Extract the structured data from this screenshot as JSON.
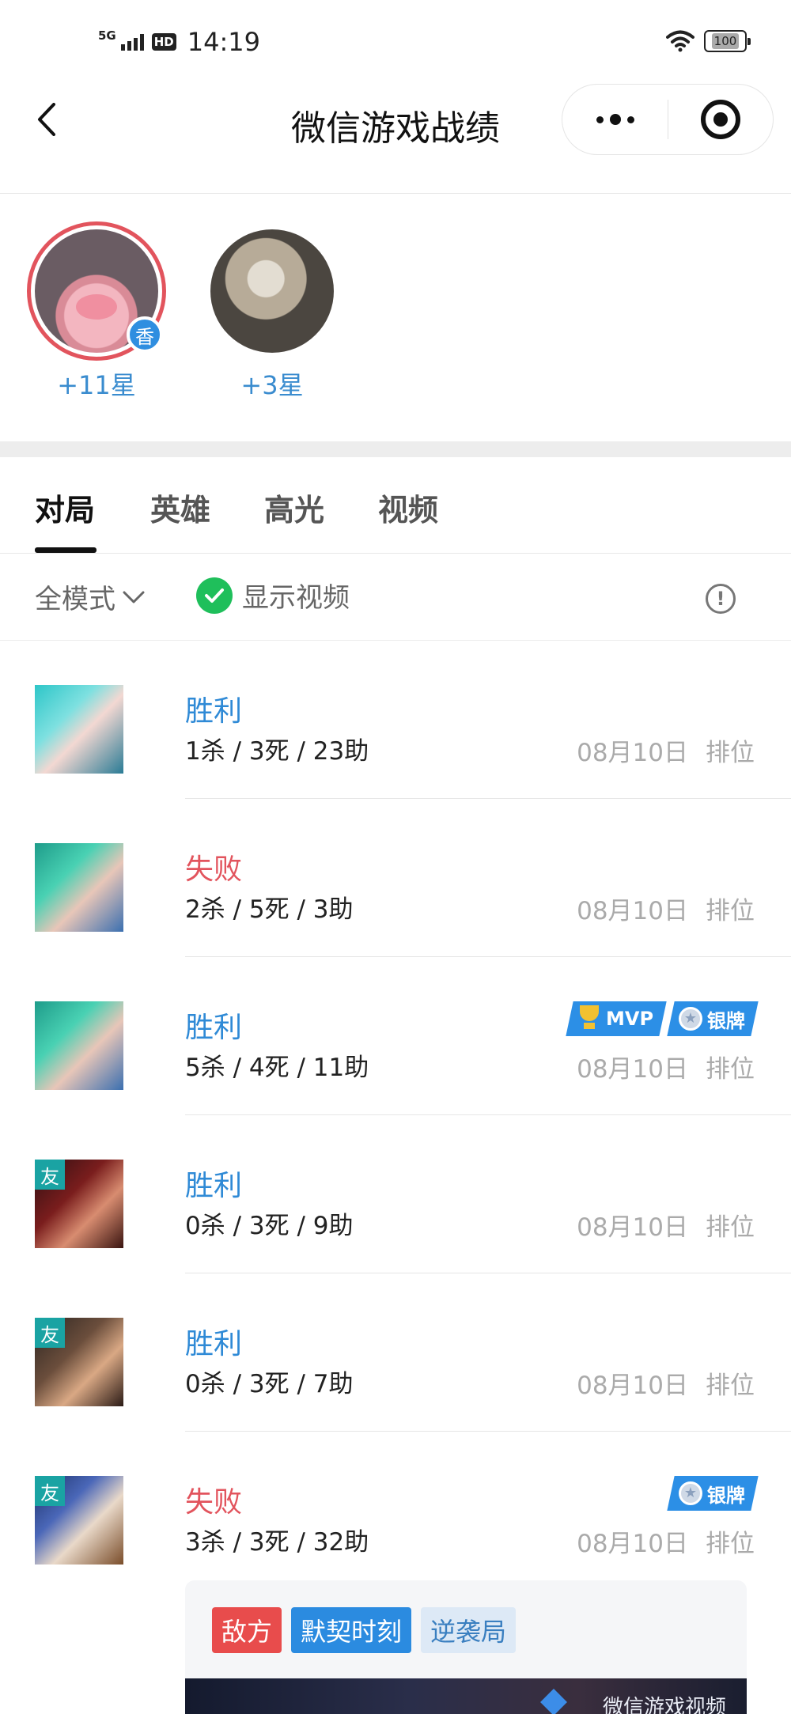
{
  "status_bar": {
    "network": "5G",
    "hd": "HD",
    "time": "14:19",
    "battery": "100"
  },
  "nav": {
    "title": "微信游戏战绩"
  },
  "friends": [
    {
      "label": "+11星",
      "badge": "香"
    },
    {
      "label": "+3星"
    }
  ],
  "tabs": [
    "对局",
    "英雄",
    "高光",
    "视频"
  ],
  "filter": {
    "mode": "全模式",
    "show_video": "显示视频",
    "info": "!"
  },
  "matches": [
    {
      "result": "胜利",
      "kda": "1杀 / 3死 / 23助",
      "date": "08月10日",
      "mode": "排位"
    },
    {
      "result": "失败",
      "kda": "2杀 / 5死 / 3助",
      "date": "08月10日",
      "mode": "排位"
    },
    {
      "result": "胜利",
      "kda": "5杀 / 4死 / 11助",
      "date": "08月10日",
      "mode": "排位",
      "badges": [
        "MVP",
        "银牌"
      ]
    },
    {
      "result": "胜利",
      "kda": "0杀 / 3死 / 9助",
      "date": "08月10日",
      "mode": "排位",
      "friend_tag": "友"
    },
    {
      "result": "胜利",
      "kda": "0杀 / 3死 / 7助",
      "date": "08月10日",
      "mode": "排位",
      "friend_tag": "友"
    },
    {
      "result": "失败",
      "kda": "3杀 / 3死 / 32助",
      "date": "08月10日",
      "mode": "排位",
      "friend_tag": "友",
      "badges": [
        "银牌"
      ]
    }
  ],
  "video_card": {
    "tags": [
      "敌方",
      "默契时刻",
      "逆袭局"
    ],
    "thumb_text": "微信游戏视频"
  },
  "colors": {
    "win": "#2f8ad6",
    "lose": "#e2545d",
    "accent_green": "#1fbf5b"
  }
}
